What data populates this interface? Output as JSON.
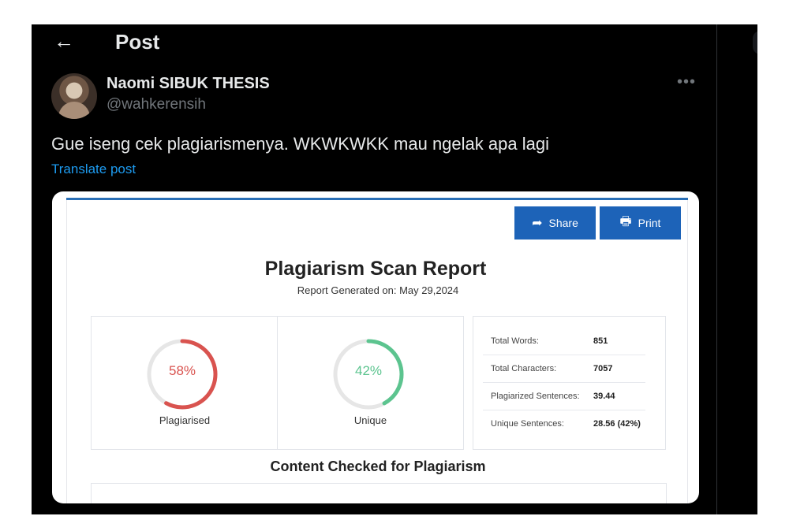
{
  "header": {
    "back_icon": "arrow-left-icon",
    "title": "Post"
  },
  "author": {
    "display_name": "Naomi SIBUK THESIS",
    "handle": "@wahkerensih",
    "more_icon": "more-horizontal-icon"
  },
  "tweet": {
    "text": "Gue iseng cek plagiarismenya. WKWKWKK mau ngelak apa lagi",
    "translate_label": "Translate post"
  },
  "report": {
    "share_label": "Share",
    "share_icon": "share-arrow-icon",
    "print_label": "Print",
    "print_icon": "printer-icon",
    "title": "Plagiarism Scan Report",
    "generated": "Report Generated on: May 29,2024",
    "plagiarised": {
      "value": "58%",
      "fraction": 0.58,
      "label": "Plagiarised",
      "color": "#d9534f"
    },
    "unique": {
      "value": "42%",
      "fraction": 0.42,
      "label": "Unique",
      "color": "#5cc48f"
    },
    "stats": [
      {
        "label": "Total Words:",
        "value": "851"
      },
      {
        "label": "Total Characters:",
        "value": "7057"
      },
      {
        "label": "Plagiarized Sentences:",
        "value": "39.44"
      },
      {
        "label": "Unique Sentences:",
        "value": "28.56 (42%)"
      }
    ],
    "content_title": "Content Checked for Plagiarism"
  },
  "colors": {
    "background": "#000000",
    "text": "#e7e9ea",
    "muted": "#71767b",
    "link": "#1d9bf0",
    "button": "#1d63b8"
  }
}
